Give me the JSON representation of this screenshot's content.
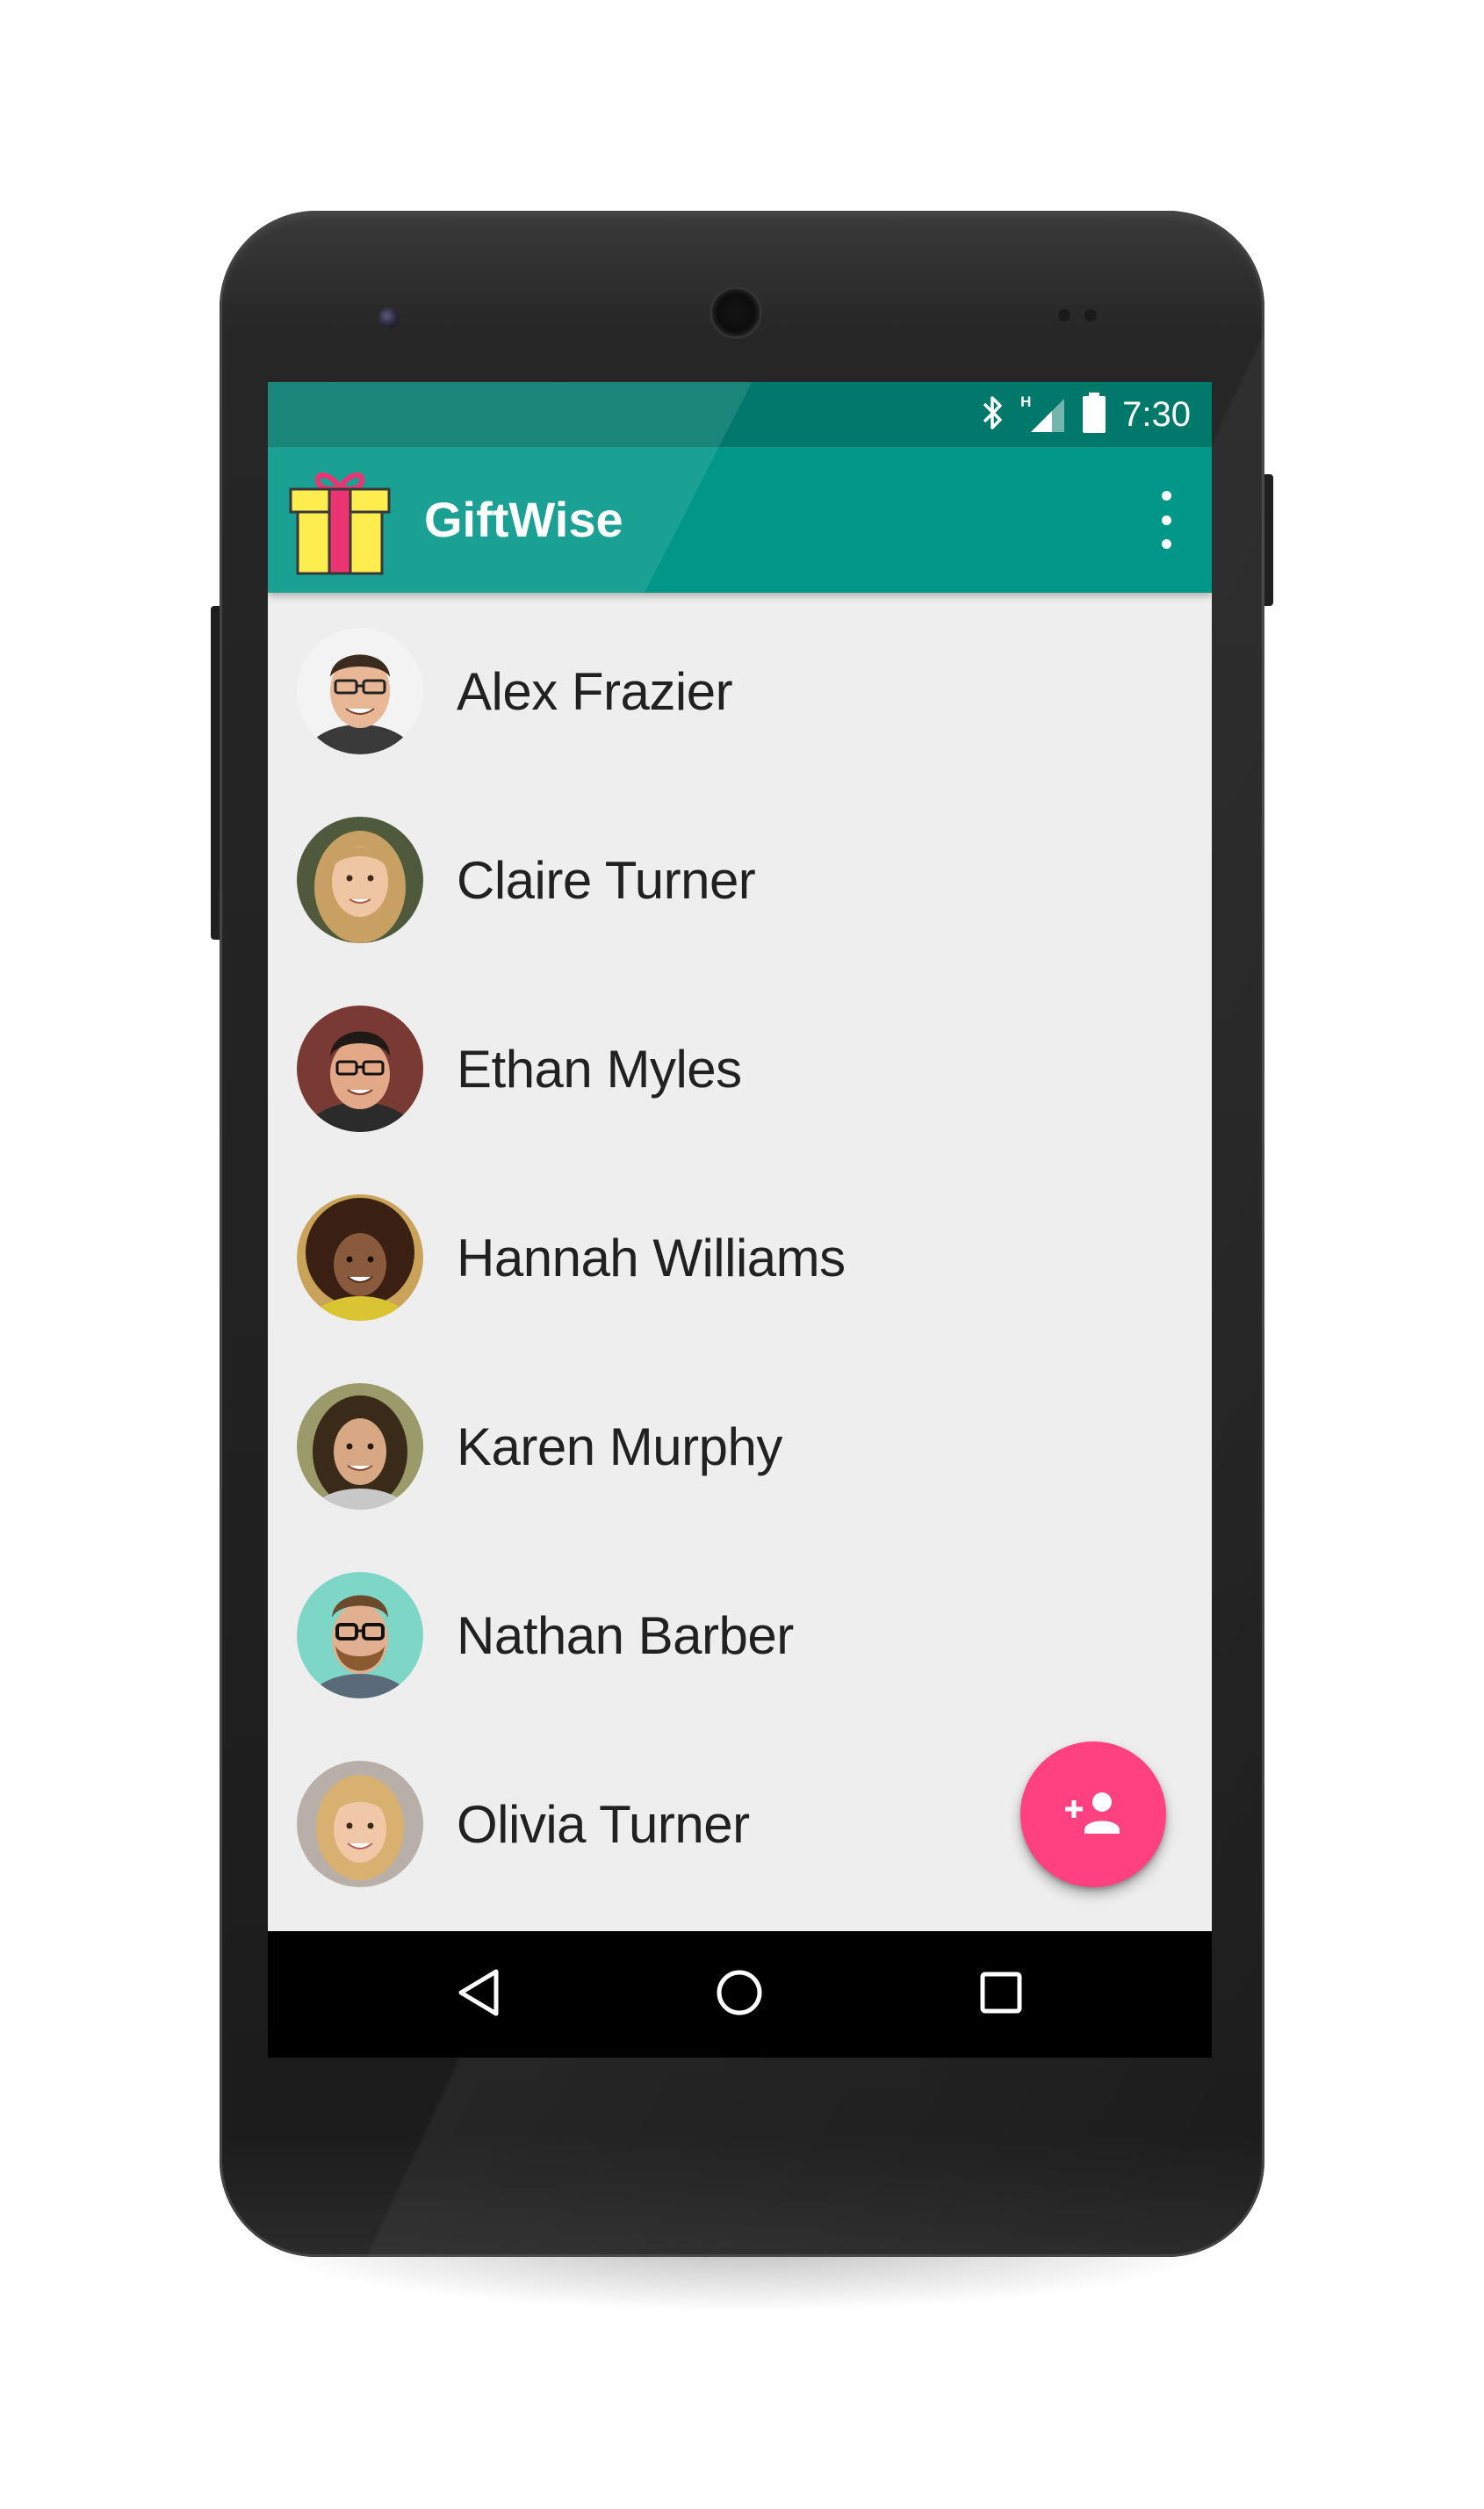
{
  "status_bar": {
    "time": "7:30",
    "network_label": "H",
    "icons": [
      "bluetooth-icon",
      "signal-icon",
      "battery-icon"
    ]
  },
  "app_bar": {
    "title": "GiftWise",
    "logo": "gift-icon",
    "menu_icon": "more-vert-icon"
  },
  "contacts": [
    {
      "name": "Alex Frazier",
      "avatar": "avatar-photo"
    },
    {
      "name": "Claire Turner",
      "avatar": "avatar-photo"
    },
    {
      "name": "Ethan Myles",
      "avatar": "avatar-photo"
    },
    {
      "name": "Hannah Williams",
      "avatar": "avatar-photo"
    },
    {
      "name": "Karen Murphy",
      "avatar": "avatar-photo"
    },
    {
      "name": "Nathan Barber",
      "avatar": "avatar-photo"
    },
    {
      "name": "Olivia Turner",
      "avatar": "avatar-photo"
    }
  ],
  "fab": {
    "icon": "person-add-icon"
  },
  "nav_bar": {
    "back_icon": "back-icon",
    "home_icon": "home-icon",
    "recents_icon": "recents-icon"
  },
  "colors": {
    "primary": "#009688",
    "primary_dark": "#00796b",
    "accent": "#ff4081",
    "list_background": "#eeeeee",
    "text_primary": "#212121"
  }
}
